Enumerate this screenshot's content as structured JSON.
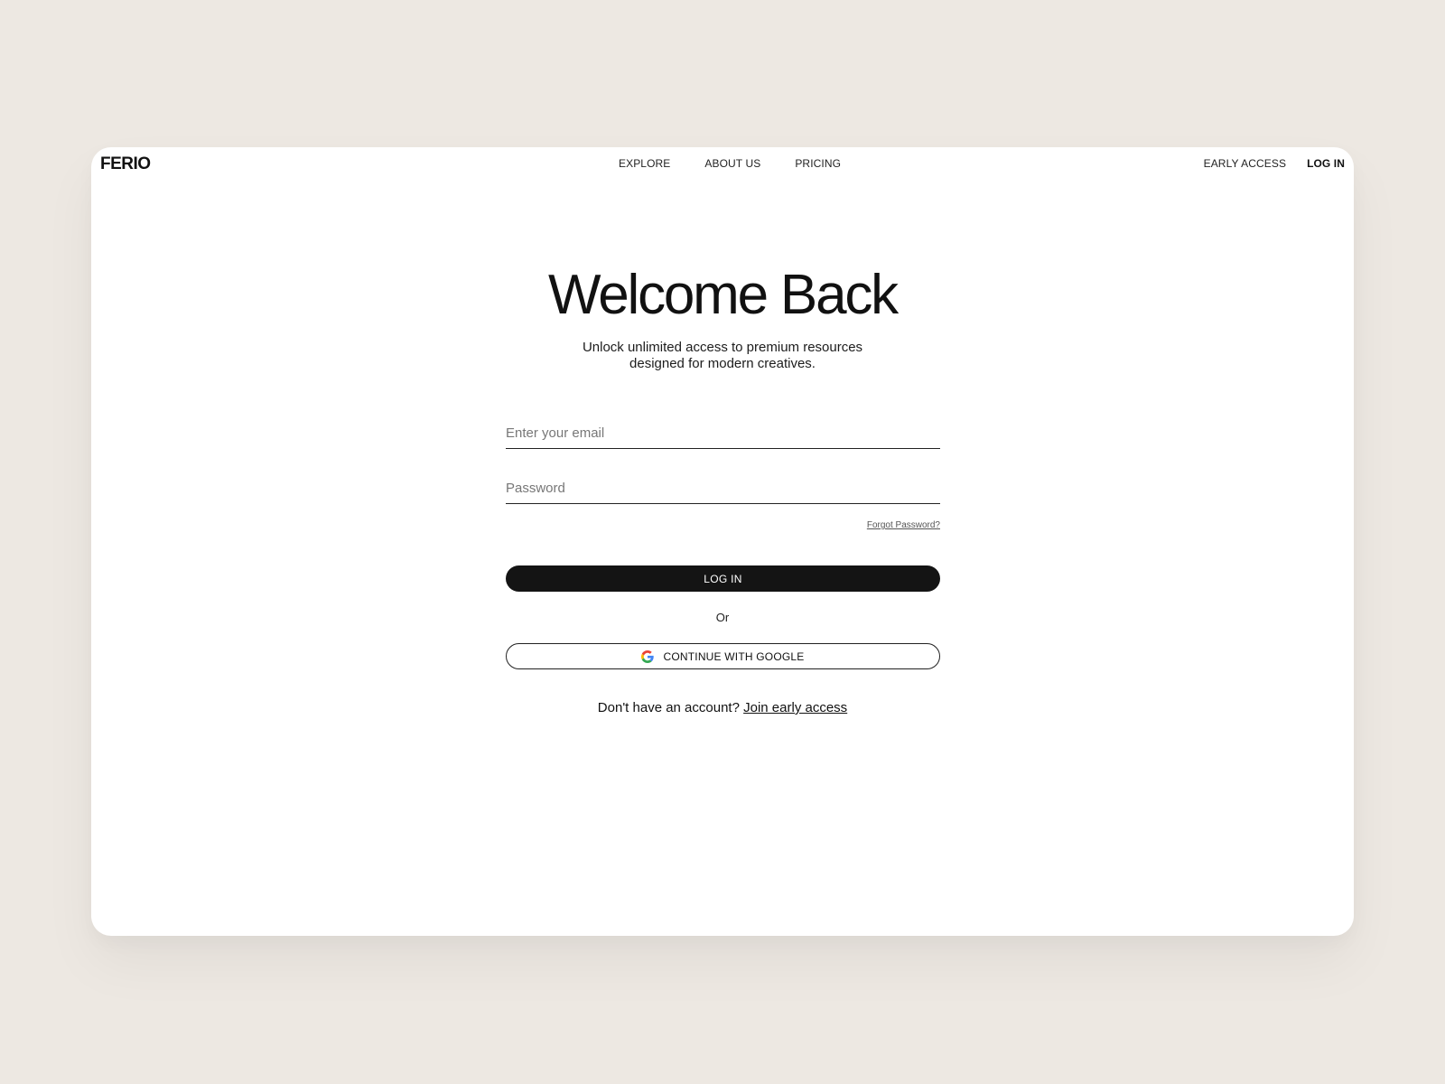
{
  "brand": {
    "logo": "FERIO"
  },
  "nav": {
    "center": [
      {
        "label": "EXPLORE"
      },
      {
        "label": "ABOUT US"
      },
      {
        "label": "PRICING"
      }
    ],
    "early_access": "EARLY ACCESS",
    "login": "LOG IN"
  },
  "hero": {
    "title": "Welcome Back",
    "subtitle_line1": "Unlock unlimited access to premium resources",
    "subtitle_line2": "designed for modern creatives."
  },
  "form": {
    "email_placeholder": "Enter your email",
    "email_value": "",
    "password_placeholder": "Password",
    "password_value": "",
    "forgot_label": "Forgot Password?",
    "login_button": "LOG IN",
    "divider": "Or",
    "google_button": "CONTINUE WITH GOOGLE",
    "google_icon": "google-icon"
  },
  "footer": {
    "prompt": "Don't have an account?",
    "link": "Join early access"
  },
  "colors": {
    "page_background": "#ede8e2",
    "card_background": "#ffffff",
    "primary_button": "#141414",
    "text": "#111111"
  }
}
